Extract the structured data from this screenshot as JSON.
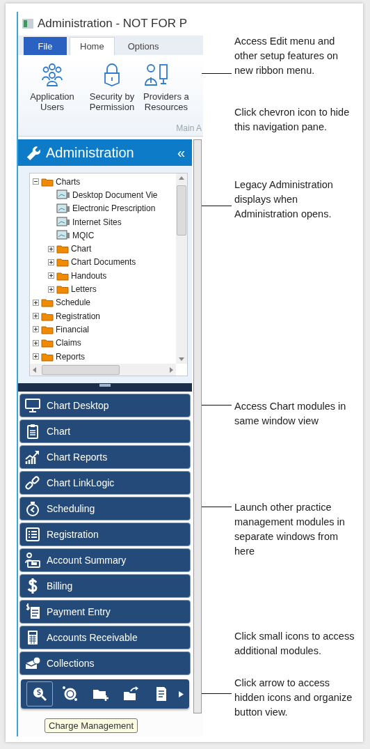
{
  "window": {
    "title": "Administration - NOT FOR P"
  },
  "tabs": [
    {
      "label": "File",
      "kind": "file",
      "selected": false
    },
    {
      "label": "Home",
      "kind": "tab",
      "selected": true
    },
    {
      "label": "Options",
      "kind": "tab",
      "selected": false
    }
  ],
  "ribbon": {
    "buttons": [
      {
        "lines": [
          "Application",
          "Users"
        ]
      },
      {
        "lines": [
          "Security by",
          "Permission"
        ]
      },
      {
        "lines": [
          "Providers a",
          "Resources"
        ]
      }
    ],
    "group_label": "Main A"
  },
  "nav_pane": {
    "title": "Administration",
    "collapse": "«"
  },
  "tree": [
    {
      "label": "Charts",
      "kind": "folder",
      "expanded": true,
      "children": [
        {
          "label": "Desktop Document Vie",
          "kind": "document"
        },
        {
          "label": "Electronic Prescription",
          "kind": "document"
        },
        {
          "label": "Internet Sites",
          "kind": "document"
        },
        {
          "label": "MQIC",
          "kind": "document"
        },
        {
          "label": "Chart",
          "kind": "folder",
          "expanded": false
        },
        {
          "label": "Chart Documents",
          "kind": "folder",
          "expanded": false
        },
        {
          "label": "Handouts",
          "kind": "folder",
          "expanded": false
        },
        {
          "label": "Letters",
          "kind": "folder",
          "expanded": false
        }
      ]
    },
    {
      "label": "Schedule",
      "kind": "folder",
      "expanded": false
    },
    {
      "label": "Registration",
      "kind": "folder",
      "expanded": false
    },
    {
      "label": "Financial",
      "kind": "folder",
      "expanded": false
    },
    {
      "label": "Claims",
      "kind": "folder",
      "expanded": false
    },
    {
      "label": "Reports",
      "kind": "folder",
      "expanded": false
    }
  ],
  "modules": [
    {
      "label": "Chart Desktop"
    },
    {
      "label": "Chart"
    },
    {
      "label": "Chart Reports"
    },
    {
      "label": "Chart LinkLogic"
    },
    {
      "label": "Scheduling"
    },
    {
      "label": "Registration"
    },
    {
      "label": "Account Summary"
    },
    {
      "label": "Billing"
    },
    {
      "label": "Payment Entry"
    },
    {
      "label": "Accounts Receivable"
    },
    {
      "label": "Collections"
    }
  ],
  "shortcut_bar": {
    "items": [
      {
        "selected": true
      },
      {
        "selected": false
      },
      {
        "selected": false
      },
      {
        "selected": false
      },
      {
        "selected": false
      }
    ]
  },
  "tooltip": "Charge Management",
  "callouts": [
    {
      "text": "Access Edit menu and other setup features on new ribbon menu.",
      "leader": true
    },
    {
      "text": "Click chevron icon to hide this navigation pane.",
      "leader": false
    },
    {
      "text": "Legacy Administration displays when Administration opens.",
      "leader": true
    },
    {
      "text": "Access Chart modules in same window view",
      "leader": true
    },
    {
      "text": "Launch other practice management modules in separate windows from here",
      "leader": true
    },
    {
      "text": "Click small icons to access additional modules.",
      "leader": false
    },
    {
      "text": "Click arrow to access hidden icons and organize button view.",
      "leader": true
    }
  ]
}
